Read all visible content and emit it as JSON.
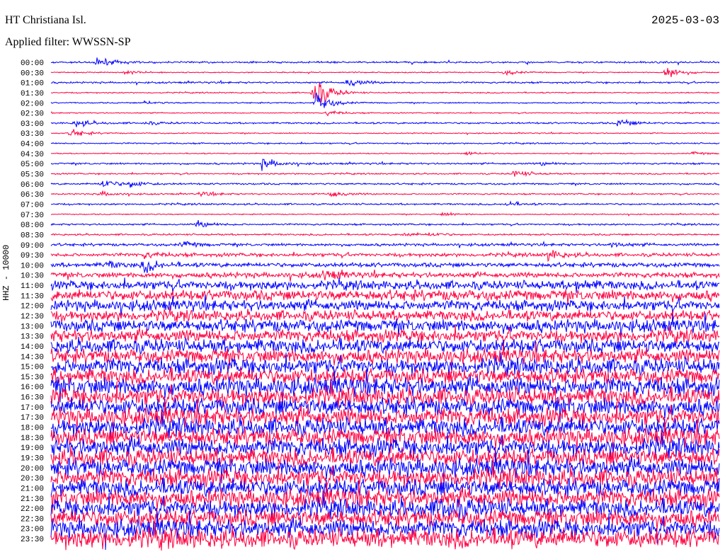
{
  "header": {
    "station": "HT Christiana Isl.",
    "date": "2025-03-03",
    "filter": "Applied filter: WWSSN-SP"
  },
  "chart_data": {
    "type": "line",
    "title": "HT Christiana Isl.",
    "ylabel": "HHZ - 10000",
    "x_unit": "minutes into row",
    "x_range": [
      0,
      30
    ],
    "colors": [
      "#0000ff",
      "#ff0040"
    ],
    "rows": [
      {
        "label": "00:00",
        "noise": 1,
        "events": [
          [
            2.1,
            6
          ]
        ]
      },
      {
        "label": "00:30",
        "noise": 0.6,
        "events": [
          [
            27.6,
            8
          ],
          [
            20.4,
            3
          ],
          [
            3.3,
            2
          ]
        ]
      },
      {
        "label": "01:00",
        "noise": 1,
        "events": [
          [
            13.3,
            6
          ]
        ]
      },
      {
        "label": "01:30",
        "noise": 0.7,
        "events": [
          [
            11.8,
            22
          ]
        ]
      },
      {
        "label": "02:00",
        "noise": 0.7,
        "events": [
          [
            11.9,
            12
          ],
          [
            4.2,
            2
          ]
        ]
      },
      {
        "label": "02:30",
        "noise": 0.6,
        "events": [
          [
            12.4,
            3
          ]
        ]
      },
      {
        "label": "03:00",
        "noise": 1,
        "events": [
          [
            1.1,
            5
          ],
          [
            25.5,
            5
          ],
          [
            4.2,
            2
          ]
        ]
      },
      {
        "label": "03:30",
        "noise": 0.6,
        "events": [
          [
            0.9,
            5
          ]
        ]
      },
      {
        "label": "04:00",
        "noise": 0.8,
        "events": []
      },
      {
        "label": "04:30",
        "noise": 0.6,
        "events": [
          [
            18.7,
            2
          ],
          [
            28.8,
            2
          ]
        ]
      },
      {
        "label": "05:00",
        "noise": 1,
        "events": [
          [
            9.5,
            7
          ],
          [
            22,
            2
          ]
        ]
      },
      {
        "label": "05:30",
        "noise": 0.8,
        "events": [
          [
            20.8,
            5
          ]
        ]
      },
      {
        "label": "06:00",
        "noise": 1,
        "events": [
          [
            2.3,
            6
          ],
          [
            3.5,
            4
          ]
        ]
      },
      {
        "label": "06:30",
        "noise": 0.8,
        "events": [
          [
            12.5,
            5
          ],
          [
            2.2,
            3
          ],
          [
            6.7,
            3
          ]
        ]
      },
      {
        "label": "07:00",
        "noise": 1,
        "events": [
          [
            20.4,
            3
          ]
        ]
      },
      {
        "label": "07:30",
        "noise": 0.6,
        "events": [
          [
            17.6,
            2
          ]
        ]
      },
      {
        "label": "08:00",
        "noise": 1,
        "events": [
          [
            6.6,
            4
          ]
        ]
      },
      {
        "label": "08:30",
        "noise": 1,
        "events": [
          [
            15.8,
            2
          ],
          [
            17,
            2
          ]
        ]
      },
      {
        "label": "09:00",
        "noise": 1.5,
        "events": [
          [
            5.9,
            4
          ],
          [
            25.2,
            3
          ]
        ]
      },
      {
        "label": "09:30",
        "noise": 2,
        "events": [
          [
            22.3,
            6
          ],
          [
            4.2,
            3
          ]
        ]
      },
      {
        "label": "10:00",
        "noise": 2.5,
        "events": [
          [
            4.2,
            8
          ],
          [
            2.5,
            4
          ]
        ]
      },
      {
        "label": "10:30",
        "noise": 3,
        "events": [
          [
            12.3,
            5
          ]
        ]
      },
      {
        "label": "11:00",
        "noise": 5,
        "events": [
          [
            23.5,
            5
          ]
        ]
      },
      {
        "label": "11:30",
        "noise": 6,
        "events": []
      },
      {
        "label": "12:00",
        "noise": 6,
        "events": []
      },
      {
        "label": "12:30",
        "noise": 6,
        "events": []
      },
      {
        "label": "13:00",
        "noise": 7,
        "events": []
      },
      {
        "label": "13:30",
        "noise": 7,
        "events": []
      },
      {
        "label": "14:00",
        "noise": 8,
        "events": []
      },
      {
        "label": "14:30",
        "noise": 8,
        "events": []
      },
      {
        "label": "15:00",
        "noise": 9,
        "events": []
      },
      {
        "label": "15:30",
        "noise": 9,
        "events": []
      },
      {
        "label": "16:00",
        "noise": 10,
        "events": []
      },
      {
        "label": "16:30",
        "noise": 10,
        "events": []
      },
      {
        "label": "17:00",
        "noise": 10,
        "events": []
      },
      {
        "label": "17:30",
        "noise": 10,
        "events": []
      },
      {
        "label": "18:00",
        "noise": 10,
        "events": []
      },
      {
        "label": "18:30",
        "noise": 10,
        "events": []
      },
      {
        "label": "19:00",
        "noise": 10,
        "events": []
      },
      {
        "label": "19:30",
        "noise": 10,
        "events": []
      },
      {
        "label": "20:00",
        "noise": 10,
        "events": []
      },
      {
        "label": "20:30",
        "noise": 10,
        "events": []
      },
      {
        "label": "21:00",
        "noise": 10,
        "events": []
      },
      {
        "label": "21:30",
        "noise": 10,
        "events": []
      },
      {
        "label": "22:00",
        "noise": 10,
        "events": [
          [
            17.6,
            14
          ]
        ]
      },
      {
        "label": "22:30",
        "noise": 10,
        "events": []
      },
      {
        "label": "23:00",
        "noise": 10,
        "events": []
      },
      {
        "label": "23:30",
        "noise": 11,
        "events": []
      }
    ]
  }
}
